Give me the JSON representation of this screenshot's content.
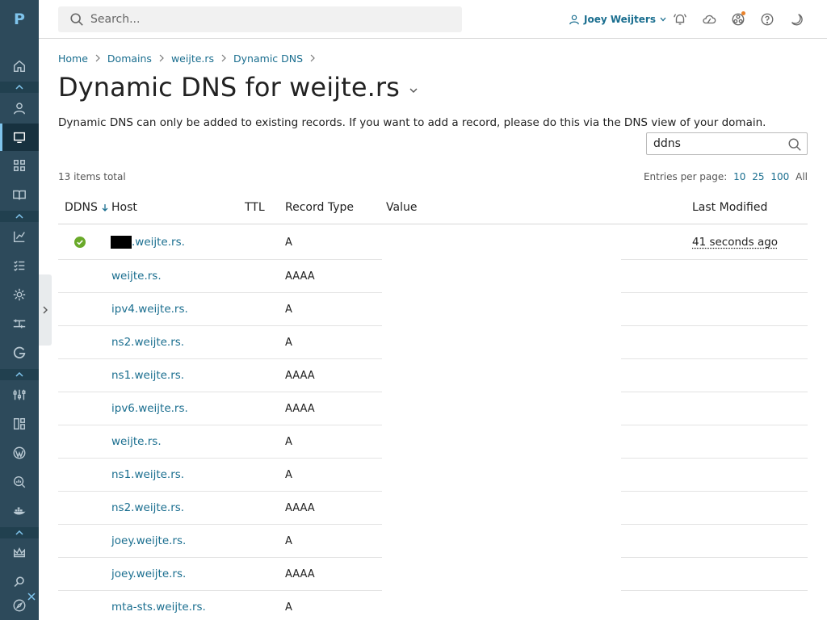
{
  "app": {
    "logo": "P"
  },
  "sidebar": {
    "items": [
      {
        "icon": "home-icon"
      },
      {
        "icon": "user-icon"
      },
      {
        "icon": "monitor-icon"
      },
      {
        "icon": "apps-grid-icon"
      },
      {
        "icon": "book-icon"
      },
      {
        "icon": "chart-icon"
      },
      {
        "icon": "checklist-icon"
      },
      {
        "icon": "gear-icon"
      },
      {
        "icon": "tools-icon"
      },
      {
        "icon": "google-icon"
      },
      {
        "icon": "sliders-icon"
      },
      {
        "icon": "extensions-icon"
      },
      {
        "icon": "wordpress-icon"
      },
      {
        "icon": "seo-icon"
      },
      {
        "icon": "docker-icon"
      },
      {
        "icon": "crown-icon"
      },
      {
        "icon": "search-icon"
      },
      {
        "icon": "compass-icon"
      }
    ]
  },
  "topbar": {
    "search_placeholder": "Search...",
    "user_name": "Joey Weijters"
  },
  "breadcrumb": [
    "Home",
    "Domains",
    "weijte.rs",
    "Dynamic DNS"
  ],
  "page": {
    "title": "Dynamic DNS for weijte.rs",
    "description": "Dynamic DNS can only be added to existing records. If you want to add a record, please do this via the DNS view of your domain.",
    "filter_value": "ddns",
    "total": "13 items total",
    "entries_label": "Entries per page:",
    "entries_options": [
      "10",
      "25",
      "100"
    ],
    "entries_all": "All"
  },
  "table": {
    "columns": {
      "ddns": "DDNS",
      "host": "Host",
      "ttl": "TTL",
      "record_type": "Record Type",
      "value": "Value",
      "last_modified": "Last Modified"
    },
    "rows": [
      {
        "host": ".weijte.rs.",
        "type": "A",
        "ddns": true,
        "modified": "41 seconds ago"
      },
      {
        "host": "weijte.rs.",
        "type": "AAAA"
      },
      {
        "host": "ipv4.weijte.rs.",
        "type": "A"
      },
      {
        "host": "ns2.weijte.rs.",
        "type": "A"
      },
      {
        "host": "ns1.weijte.rs.",
        "type": "AAAA"
      },
      {
        "host": "ipv6.weijte.rs.",
        "type": "AAAA"
      },
      {
        "host": "weijte.rs.",
        "type": "A"
      },
      {
        "host": "ns1.weijte.rs.",
        "type": "A"
      },
      {
        "host": "ns2.weijte.rs.",
        "type": "AAAA"
      },
      {
        "host": "joey.weijte.rs.",
        "type": "A"
      },
      {
        "host": "joey.weijte.rs.",
        "type": "AAAA"
      },
      {
        "host": "mta-sts.weijte.rs.",
        "type": "A"
      }
    ]
  },
  "colors": {
    "sidebar": "#2d4a5b",
    "link": "#1a6e8f",
    "success": "#6aaa2a",
    "notification": "#e8812a"
  }
}
